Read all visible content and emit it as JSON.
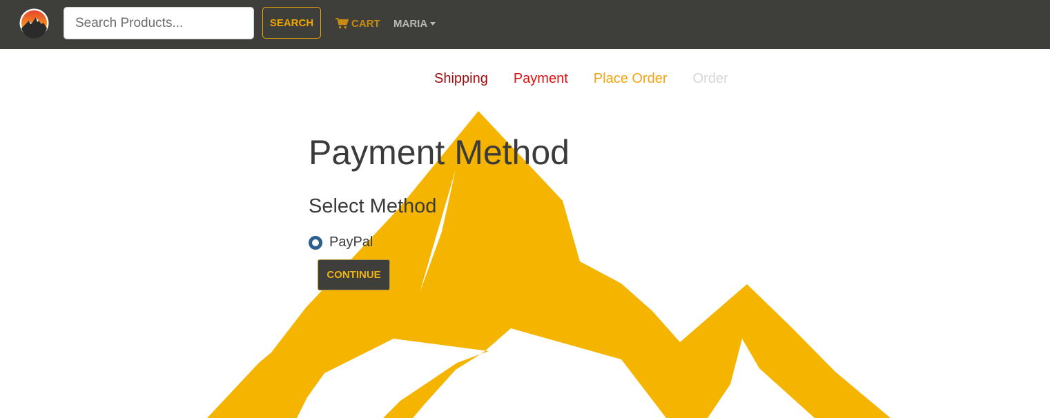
{
  "navbar": {
    "logo_icon": "mountain-sun-logo-icon",
    "search": {
      "placeholder": "Search Products...",
      "value": ""
    },
    "search_button_label": "SEARCH",
    "cart": {
      "icon": "cart-icon",
      "label": "CART"
    },
    "user": {
      "label": "MARIA",
      "icon": "chevron-down-icon"
    }
  },
  "steps": {
    "shipping": "Shipping",
    "payment": "Payment",
    "place_order": "Place Order",
    "order": "Order"
  },
  "main": {
    "title": "Payment Method",
    "section_title": "Select Method",
    "payment_option": {
      "label": "PayPal",
      "selected": true
    },
    "continue_label": "CONTINUE"
  },
  "colors": {
    "navbar_bg": "#3e3e3a",
    "accent": "#f0a500",
    "mountain": "#f4b400",
    "step_shipping": "#9c0a0a",
    "step_payment": "#e01010",
    "step_place_order": "#f4a40e",
    "step_order_disabled": "#d6d6d6"
  }
}
